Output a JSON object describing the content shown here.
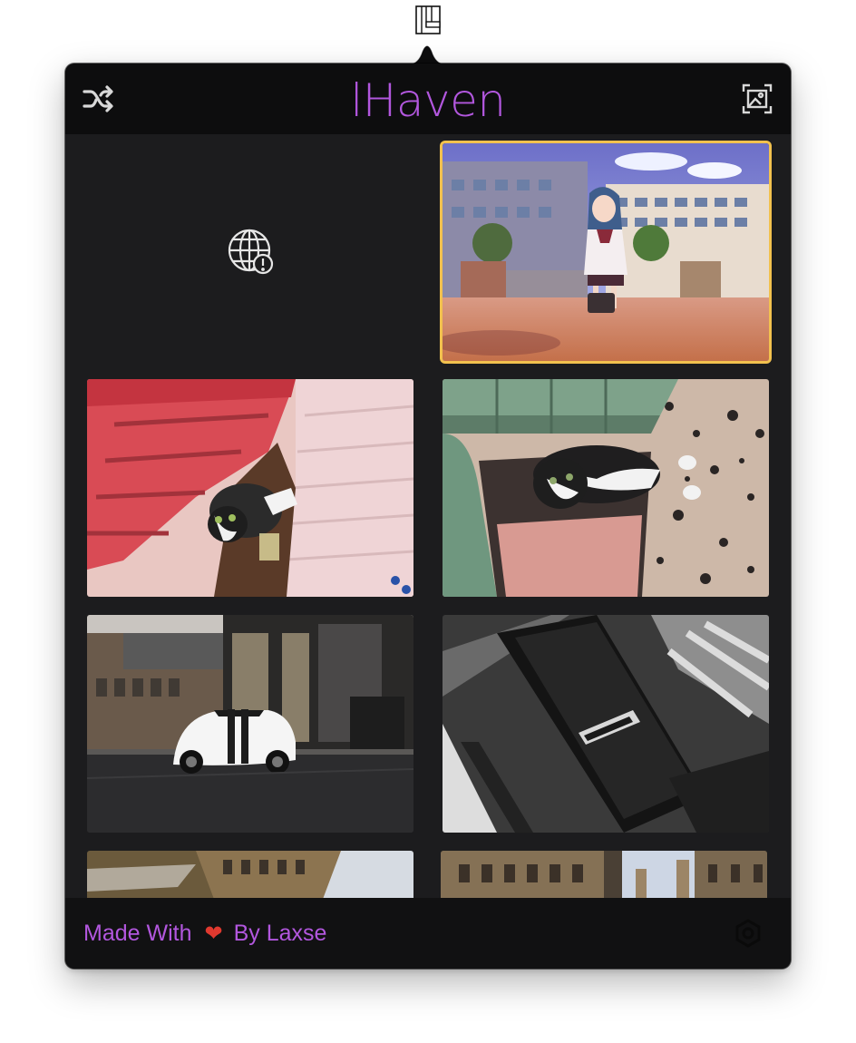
{
  "app": {
    "title": "lHaven",
    "menubar_icon": "wallpaper-app-icon"
  },
  "header": {
    "shuffle_icon": "shuffle-icon",
    "gallery_icon": "image-gallery-icon"
  },
  "grid": {
    "tiles": [
      {
        "name": "offline-placeholder",
        "icon": "globe-warning-icon",
        "state": "failed"
      },
      {
        "name": "anime-school-girl",
        "state": "selected"
      },
      {
        "name": "kitten-red-stairs"
      },
      {
        "name": "kitten-green-bench"
      },
      {
        "name": "white-mustang-street"
      },
      {
        "name": "shelby-car-detail"
      },
      {
        "name": "street-buildings-blur"
      },
      {
        "name": "old-buildings-street"
      }
    ]
  },
  "footer": {
    "made_with": "Made With",
    "heart": "❤",
    "by": "By Laxse",
    "settings_icon": "settings-icon"
  },
  "colors": {
    "accent": "#b257de",
    "selection": "#f2c14e",
    "heart": "#e0392f",
    "background": "#1c1c1e",
    "header_bg": "#0d0d0e"
  }
}
